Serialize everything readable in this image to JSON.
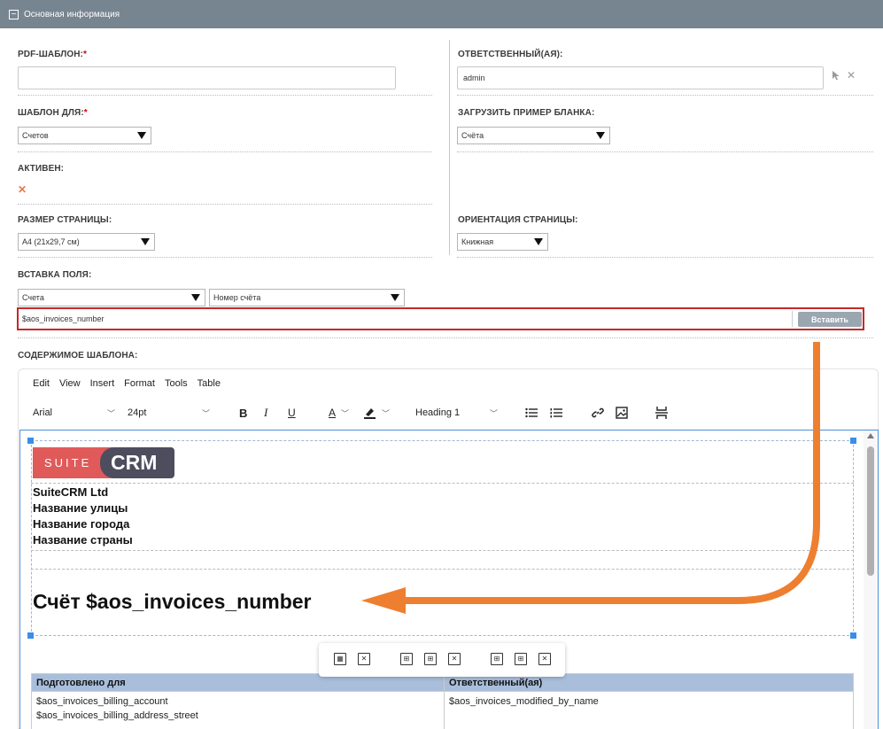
{
  "panel": {
    "title": "Основная информация",
    "toggle": "−"
  },
  "fields": {
    "pdf_template": {
      "label": "PDF-ШАБЛОН:",
      "required": "*",
      "value": ""
    },
    "responsible": {
      "label": "ОТВЕТСТВЕННЫЙ(АЯ):",
      "value": "admin"
    },
    "template_for": {
      "label": "ШАБЛОН ДЛЯ:",
      "required": "*",
      "value": "Счетов"
    },
    "load_sample": {
      "label": "ЗАГРУЗИТЬ ПРИМЕР БЛАНКА:",
      "value": "Счёта"
    },
    "active": {
      "label": "АКТИВЕН:",
      "checked_glyph": "✕"
    },
    "page_size": {
      "label": "РАЗМЕР СТРАНИЦЫ:",
      "value": "A4 (21x29,7 см)"
    },
    "orientation": {
      "label": "ОРИЕНТАЦИЯ СТРАНИЦЫ:",
      "value": "Книжная"
    },
    "insert_field": {
      "label": "ВСТАВКА ПОЛЯ:",
      "module": "Счета",
      "field": "Номер счёта",
      "variable": "$aos_invoices_number",
      "button": "Вставить"
    },
    "template_content": {
      "label": "СОДЕРЖИМОЕ ШАБЛОНА:"
    }
  },
  "editor": {
    "menu": [
      "Edit",
      "View",
      "Insert",
      "Format",
      "Tools",
      "Table"
    ],
    "font_family": "Arial",
    "font_size": "24pt",
    "bold": "B",
    "italic": "I",
    "underline": "U",
    "text_color": "A",
    "block_format": "Heading 1",
    "accent_color": "#3a8ee6",
    "content": {
      "logo_left": "SUITE",
      "logo_right": "CRM",
      "logo_left_color": "#e05a5a",
      "logo_right_color": "#4d4d5e",
      "address_lines": [
        "SuiteCRM Ltd",
        "Название улицы",
        "Название города",
        "Название страны"
      ],
      "title": "Счёт $aos_invoices_number",
      "table": {
        "headers": [
          "Подготовлено для",
          "Ответственный(ая)"
        ],
        "left_cell": [
          "$aos_invoices_billing_account",
          "$aos_invoices_billing_address_street"
        ],
        "right_cell": [
          "$aos_invoices_modified_by_name"
        ]
      }
    }
  },
  "annotation": {
    "color": "#ee7f30"
  }
}
